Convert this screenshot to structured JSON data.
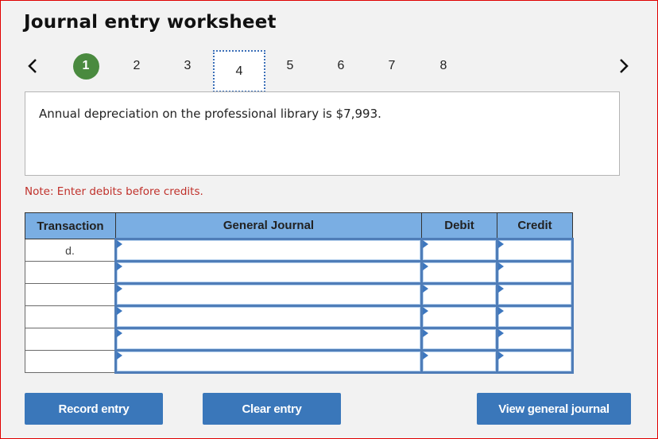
{
  "header": {
    "title": "Journal entry worksheet"
  },
  "pager": {
    "prev_icon": "chevron-left-icon",
    "next_icon": "chevron-right-icon",
    "steps": [
      {
        "label": "1",
        "state": "completed"
      },
      {
        "label": "2",
        "state": "default"
      },
      {
        "label": "3",
        "state": "default"
      },
      {
        "label": "4",
        "state": "current"
      },
      {
        "label": "5",
        "state": "default"
      },
      {
        "label": "6",
        "state": "default"
      },
      {
        "label": "7",
        "state": "default"
      },
      {
        "label": "8",
        "state": "default"
      }
    ],
    "completed_color": "#4a8a3f"
  },
  "description": "Annual depreciation on the professional library is $7,993.",
  "note": "Note: Enter debits before credits.",
  "journal": {
    "headers": {
      "transaction": "Transaction",
      "general_journal": "General Journal",
      "debit": "Debit",
      "credit": "Credit"
    },
    "rows": [
      {
        "transaction": "d.",
        "account": "",
        "debit": "",
        "credit": ""
      },
      {
        "transaction": "",
        "account": "",
        "debit": "",
        "credit": ""
      },
      {
        "transaction": "",
        "account": "",
        "debit": "",
        "credit": ""
      },
      {
        "transaction": "",
        "account": "",
        "debit": "",
        "credit": ""
      },
      {
        "transaction": "",
        "account": "",
        "debit": "",
        "credit": ""
      },
      {
        "transaction": "",
        "account": "",
        "debit": "",
        "credit": ""
      }
    ],
    "header_color": "#7aaee3"
  },
  "buttons": {
    "record": "Record entry",
    "clear": "Clear entry",
    "view": "View general journal",
    "color": "#3a77ba"
  },
  "note_color": "#c0302a"
}
